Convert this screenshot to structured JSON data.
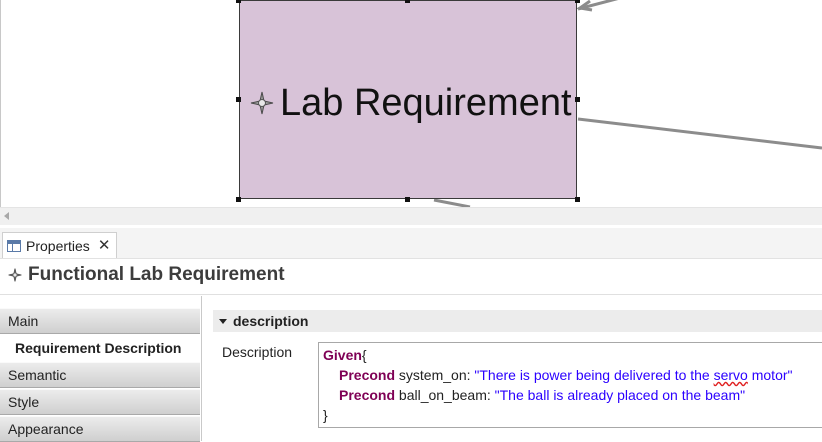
{
  "diagram": {
    "node_label": "Lab Requirement",
    "node_icon": "requirement-icon"
  },
  "properties_view": {
    "tab_label": "Properties",
    "close_icon": "close-icon",
    "header_title": "Functional Lab Requirement",
    "side_tabs": [
      "Main",
      "Requirement Description",
      "Semantic",
      "Style",
      "Appearance"
    ],
    "selected_tab": "Requirement Description",
    "section_title": "description",
    "field_label": "Description",
    "editor": {
      "line1_kw": "Given",
      "line1_brace": "{",
      "line2_kw": "Precond",
      "line2_id": " system_on: ",
      "line2_str_a": "\"There is power being delivered to the ",
      "line2_str_b": "servo",
      "line2_str_c": " motor\"",
      "line3_kw": "Precond",
      "line3_id": " ball_on_beam: ",
      "line3_str": "\"The ball is already placed on the beam\"",
      "line4_brace": "}"
    }
  },
  "colors": {
    "node_fill": "#d8c3d8",
    "keyword": "#7f0055",
    "string": "#2a00ff"
  }
}
